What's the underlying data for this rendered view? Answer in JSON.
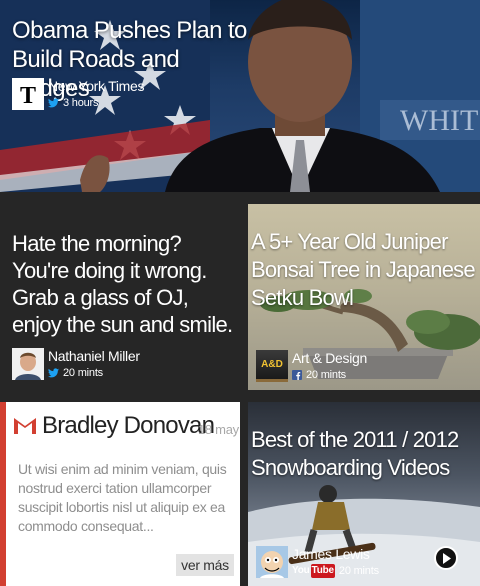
{
  "hero": {
    "title": "Obama Pushes Plan to Build Roads and Bridges",
    "source": "New York Times",
    "time": "3 hours",
    "avatar_icon": "nyt-logo-icon",
    "network_icon": "twitter-icon"
  },
  "quote": {
    "text": "Hate the morning? You're doing it wrong. Grab a glass of OJ, enjoy the sun and smile.",
    "author": "Nathaniel Miller",
    "time": "20 mints",
    "network_icon": "twitter-icon"
  },
  "bonsai": {
    "title": "A 5+ Year Old Juniper Bonsai Tree in Japanese Setku Bowl",
    "badge": "A&D",
    "source": "Art & Design",
    "time": "20 mints",
    "network_icon": "facebook-icon"
  },
  "email": {
    "sender": "Bradley Donovan",
    "date": "18 may",
    "body": "Ut wisi enim ad minim veniam, quis nostrud exerci tation ullamcorper suscipit lobortis nisl ut aliquip ex ea commodo consequat...",
    "more_label": "ver más",
    "accent_color": "#d23f31",
    "icon": "gmail-icon"
  },
  "video": {
    "title": "Best of the 2011 / 2012 Snowboarding Videos",
    "author": "James Lewis",
    "yt_you": "You",
    "yt_tube": "Tube",
    "time": "20 mints",
    "play_icon": "play-icon"
  },
  "colors": {
    "background": "#262626",
    "twitter": "#1da1f2",
    "facebook": "#3b5998",
    "youtube": "#cc181e"
  }
}
